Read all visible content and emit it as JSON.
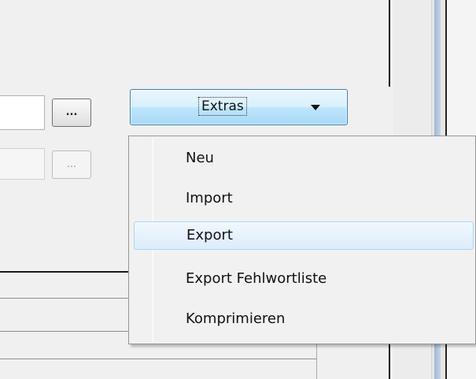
{
  "toolbar": {
    "browse_button_1_label": "...",
    "browse_button_2_label": "..."
  },
  "extras_button": {
    "label": "Extras",
    "icon": "chevron-down-icon"
  },
  "menu": {
    "items": [
      {
        "label": "Neu"
      },
      {
        "label": "Import"
      },
      {
        "label": "Export",
        "highlighted": true
      },
      {
        "label": "Export Fehlwortliste"
      },
      {
        "label": "Komprimieren"
      }
    ]
  },
  "colors": {
    "button_border": "#3c7fb1",
    "button_fill": "#bee6fd",
    "menu_background": "#f1f1f1",
    "highlight": "#dcecfa"
  }
}
